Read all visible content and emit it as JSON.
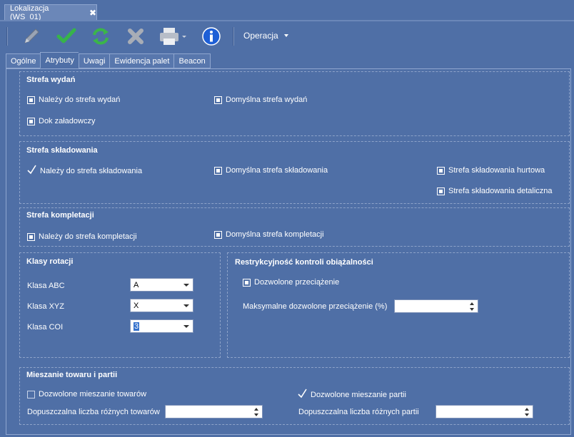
{
  "window": {
    "tab_title": "Lokalizacja (WS_01)",
    "close_label": "✖"
  },
  "toolbar": {
    "edit_icon": "pencil-icon",
    "save_icon": "green-check-icon",
    "refresh_icon": "green-refresh-icon",
    "delete_icon": "grey-x-icon",
    "print_icon": "printer-icon",
    "info_icon": "info-icon",
    "menu_label": "Operacja"
  },
  "tabs": [
    {
      "label": "Ogólne",
      "active": false
    },
    {
      "label": "Atrybuty",
      "active": true
    },
    {
      "label": "Uwagi",
      "active": false
    },
    {
      "label": "Ewidencja palet",
      "active": false
    },
    {
      "label": "Beacon",
      "active": false
    }
  ],
  "strefa_wydan": {
    "title": "Strefa wydań",
    "nalezy": {
      "label": "Należy do strefa wydań",
      "state": "indeterminate"
    },
    "domyslna": {
      "label": "Domyślna strefa wydań",
      "state": "indeterminate"
    },
    "dok": {
      "label": "Dok załadowczy",
      "state": "indeterminate"
    }
  },
  "strefa_skladowania": {
    "title": "Strefa składowania",
    "nalezy": {
      "label": "Należy do strefa składowania",
      "state": "checked"
    },
    "domyslna": {
      "label": "Domyślna strefa składowania",
      "state": "indeterminate"
    },
    "hurtowa": {
      "label": "Strefa składowania hurtowa",
      "state": "indeterminate"
    },
    "detaliczna": {
      "label": "Strefa składowania detaliczna",
      "state": "indeterminate"
    }
  },
  "strefa_kompletacji": {
    "title": "Strefa kompletacji",
    "nalezy": {
      "label": "Należy do strefa kompletacji",
      "state": "indeterminate"
    },
    "domyslna": {
      "label": "Domyślna strefa kompletacji",
      "state": "indeterminate"
    }
  },
  "klasy_rotacji": {
    "title": "Klasy rotacji",
    "abc": {
      "label": "Klasa ABC",
      "value": "A"
    },
    "xyz": {
      "label": "Klasa XYZ",
      "value": "X"
    },
    "coi": {
      "label": "Klasa COI",
      "value": "3"
    }
  },
  "restrykcyjnosc": {
    "title": "Restrykcyjność kontroli obiążalności",
    "dozwolone": {
      "label": "Dozwolone przeciążenie",
      "state": "indeterminate"
    },
    "max_label": "Maksymalne dozwolone przeciążenie (%)",
    "max_value": ""
  },
  "mieszanie": {
    "title": "Mieszanie towaru i partii",
    "towarow": {
      "label": "Dozwolone mieszanie towarów",
      "state": "unchecked"
    },
    "partii": {
      "label": "Dozwolone mieszanie partii",
      "state": "checked"
    },
    "liczba_towarow_label": "Dopuszczalna liczba różnych towarów",
    "liczba_towarow_value": "",
    "liczba_partii_label": "Dopuszczalna liczba różnych partii",
    "liczba_partii_value": ""
  }
}
